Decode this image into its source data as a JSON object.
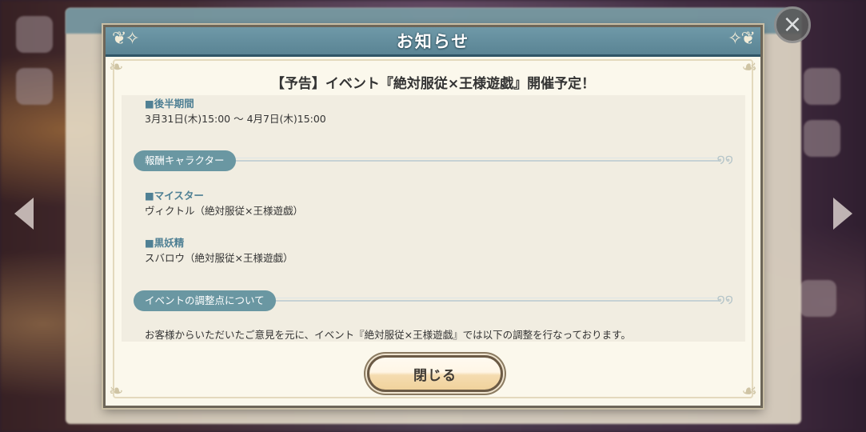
{
  "dialog": {
    "title": "お知らせ",
    "notice_title": "【予告】イベント『絶対服従×王様遊戯』開催予定！",
    "close_label": "閉じる"
  },
  "content": {
    "period_heading": "■後半期間",
    "period_value": "3月31日(木)15:00 〜 4月7日(木)15:00",
    "reward_section": "報酬キャラクター",
    "meister_heading": "■マイスター",
    "meister_value": "ヴィクトル（絶対服従×王様遊戯）",
    "fairy_heading": "■黒妖精",
    "fairy_value": "スバロウ（絶対服従×王様遊戯）",
    "adjust_section": "イベントの調整点について",
    "adjust_text": "お客様からいただいたご意見を元に、イベント『絶対服従×王様遊戯』では以下の調整を行なっております。"
  },
  "colors": {
    "header": "#5e8796",
    "section_pill": "#6a97a2",
    "subheading_text": "#4f8094",
    "panel_bg": "#fbf8ec",
    "content_bg": "#f1ede1"
  },
  "icons": {
    "close": "close-x-icon",
    "nav_left": "arrow-left-icon",
    "nav_right": "arrow-right-icon",
    "header_ornament": "swirl-ornament-icon"
  }
}
